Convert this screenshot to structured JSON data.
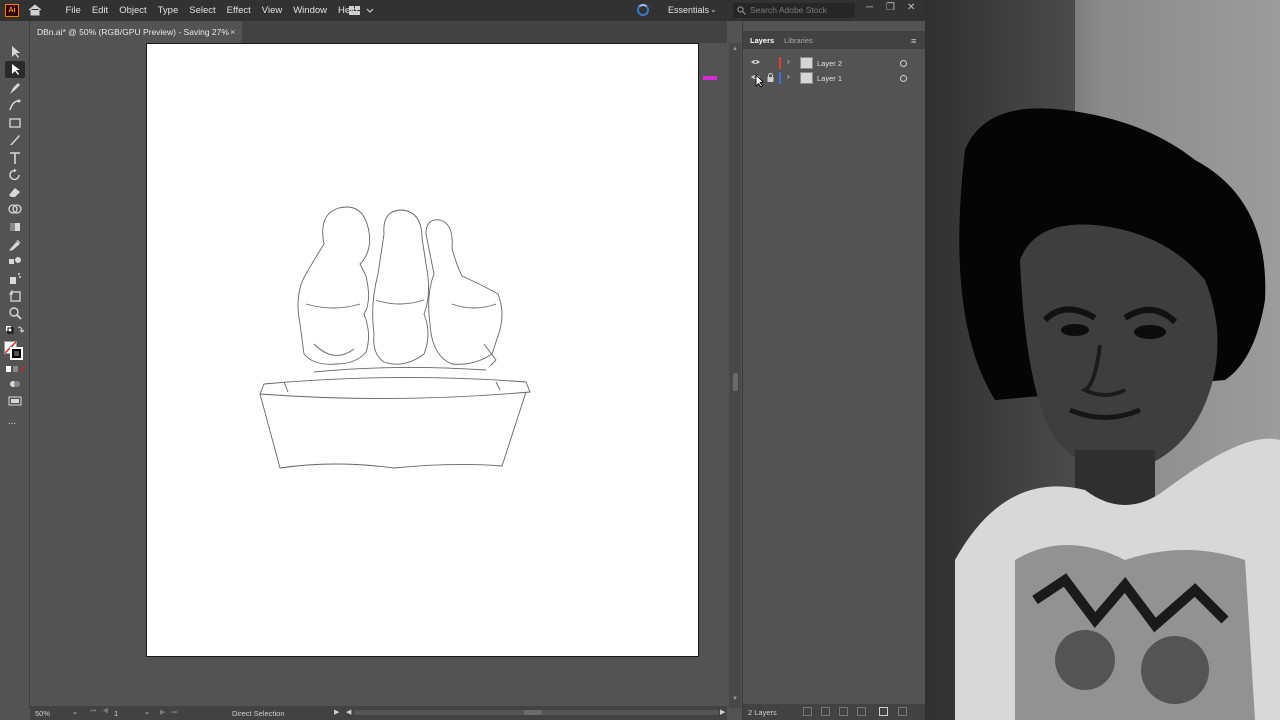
{
  "menubar": {
    "logo": "Ai",
    "items": [
      "File",
      "Edit",
      "Object",
      "Type",
      "Select",
      "Effect",
      "View",
      "Window",
      "Help"
    ],
    "workspace": "Essentials",
    "search_placeholder": "Search Adobe Stock",
    "window_buttons": [
      "─",
      "❐",
      "✕"
    ]
  },
  "document": {
    "tab_title": "DBn.ai* @ 50% (RGB/GPU Preview)  - Saving 27%",
    "close": "×"
  },
  "toolbar": {
    "tools": [
      "selection-tool",
      "direct-selection-tool",
      "pen-tool",
      "curvature-tool",
      "rectangle-tool",
      "paintbrush-tool",
      "type-tool",
      "rotate-tool",
      "eraser-tool",
      "shape-builder-tool",
      "gradient-tool",
      "eyedropper-tool",
      "blend-tool",
      "symbol-sprayer-tool",
      "artboard-tool",
      "zoom-tool"
    ],
    "more": "..."
  },
  "statusbar": {
    "zoom": "50%",
    "page": "1",
    "tool_name": "Direct Selection",
    "nav_first_prev": "⏮ ◀",
    "nav_next_last": "▶ ⏭"
  },
  "layers_panel": {
    "tabs": [
      "Layers",
      "Libraries"
    ],
    "layers": [
      {
        "name": "Layer 2",
        "color": "#e03c3c",
        "visible": true,
        "locked": false
      },
      {
        "name": "Layer 1",
        "color": "#3c6fe0",
        "visible": true,
        "locked": true
      }
    ],
    "count": "2 Layers"
  },
  "colors": {
    "app_bg": "#535353",
    "menubar_bg": "#323232",
    "accent_orange": "#ff9a00",
    "artboard": "#ffffff"
  }
}
